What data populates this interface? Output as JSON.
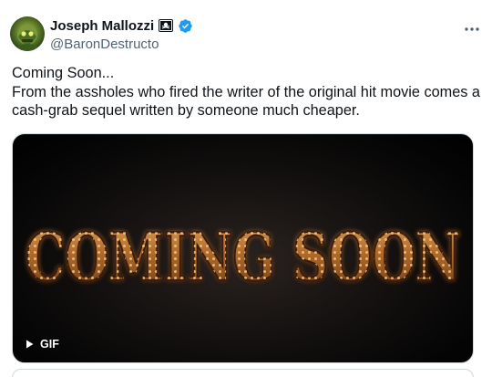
{
  "user": {
    "display_name": "Joseph Mallozzi",
    "handle": "@BaronDestructo",
    "flag_icon": "pirate-flag-icon",
    "verified_icon": "verified-badge-icon",
    "verified_color": "#1d9bf0"
  },
  "tweet": {
    "text_lines": [
      "Coming Soon...",
      "From the assholes who fired the writer of the original hit movie comes a",
      "cash-grab sequel written by someone much cheaper."
    ]
  },
  "media": {
    "marquee_text": "COMING SOON",
    "badge_label": "GIF",
    "badge_icon": "play-icon"
  },
  "menu": {
    "icon": "more-icon"
  }
}
